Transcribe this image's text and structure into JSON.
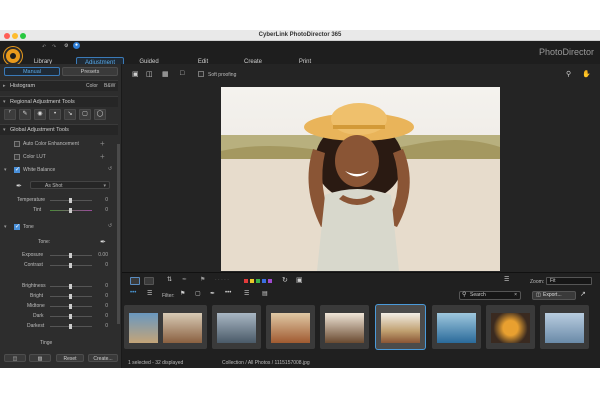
{
  "window": {
    "title": "CyberLink PhotoDirector 365"
  },
  "menu": {
    "tabs": [
      {
        "label": "Library"
      },
      {
        "label": "Adjustment"
      },
      {
        "label": "Guided"
      },
      {
        "label": "Edit"
      },
      {
        "label": "Create"
      },
      {
        "label": "Print"
      }
    ],
    "active_tab": "Adjustment",
    "brand": "PhotoDirector"
  },
  "left_panel": {
    "mode_manual": "Manual",
    "mode_presets": "Presets",
    "histogram": {
      "label": "Histogram",
      "color": "Color",
      "bw": "B&W"
    },
    "regional_tools": "Regional Adjustment Tools",
    "global_tools": "Global Adjustment Tools",
    "auto_color": "Auto Color Enhancement",
    "color_lut": "Color LUT",
    "white_balance": {
      "label": "White Balance",
      "preset": "As Shot",
      "temperature": {
        "label": "Temperature",
        "value": "0"
      },
      "tint": {
        "label": "Tint",
        "value": "0"
      }
    },
    "tone": {
      "label": "Tone",
      "tone_sub": "Tone:",
      "exposure": {
        "label": "Exposure",
        "value": "0.00"
      },
      "contrast": {
        "label": "Contrast",
        "value": "0"
      },
      "brightness": {
        "label": "Brightness",
        "value": "0"
      },
      "bright": {
        "label": "Bright",
        "value": "0"
      },
      "midtone": {
        "label": "Midtone",
        "value": "0"
      },
      "dark": {
        "label": "Dark",
        "value": "0"
      },
      "darkest": {
        "label": "Darkest",
        "value": "0"
      }
    },
    "tinge": "Tinge",
    "reset": "Reset",
    "create": "Create..."
  },
  "toolbar": {
    "soft_proofing": "Soft proofing"
  },
  "filmstrip": {
    "filter_label": "Filter:",
    "search_placeholder": "Search",
    "zoom_label": "Zoom:",
    "zoom_value": "Fit",
    "export": "Export...",
    "status_selected": "1 selected - 32 displayed",
    "status_path": "Collection / All Photos / 1115157008.jpg"
  },
  "colors": {
    "accent": "#4a9ad9",
    "logo": "#e89a1c",
    "label_colors": [
      "#e23b3b",
      "#e8c72a",
      "#3bb34a",
      "#3a6ee0",
      "#a04ad0"
    ]
  }
}
